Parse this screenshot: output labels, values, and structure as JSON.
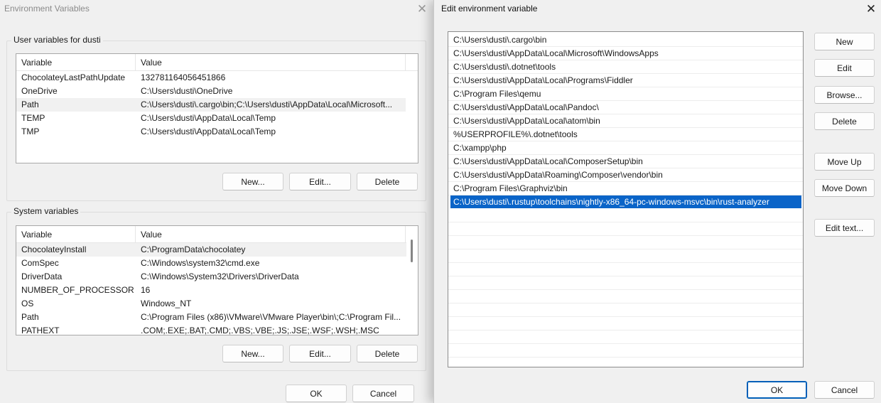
{
  "env_dialog": {
    "title": "Environment Variables",
    "user_group_label": "User variables for dusti",
    "system_group_label": "System variables",
    "columns": {
      "variable": "Variable",
      "value": "Value"
    },
    "user_vars": [
      {
        "name": "ChocolateyLastPathUpdate",
        "value": "132781164056451866"
      },
      {
        "name": "OneDrive",
        "value": "C:\\Users\\dusti\\OneDrive"
      },
      {
        "name": "Path",
        "value": "C:\\Users\\dusti\\.cargo\\bin;C:\\Users\\dusti\\AppData\\Local\\Microsoft..."
      },
      {
        "name": "TEMP",
        "value": "C:\\Users\\dusti\\AppData\\Local\\Temp"
      },
      {
        "name": "TMP",
        "value": "C:\\Users\\dusti\\AppData\\Local\\Temp"
      }
    ],
    "system_vars": [
      {
        "name": "ChocolateyInstall",
        "value": "C:\\ProgramData\\chocolatey"
      },
      {
        "name": "ComSpec",
        "value": "C:\\Windows\\system32\\cmd.exe"
      },
      {
        "name": "DriverData",
        "value": "C:\\Windows\\System32\\Drivers\\DriverData"
      },
      {
        "name": "NUMBER_OF_PROCESSORS",
        "value": "16"
      },
      {
        "name": "OS",
        "value": "Windows_NT"
      },
      {
        "name": "Path",
        "value": "C:\\Program Files (x86)\\VMware\\VMware Player\\bin\\;C:\\Program Fil..."
      },
      {
        "name": "PATHEXT",
        "value": ".COM;.EXE;.BAT;.CMD;.VBS;.VBE;.JS;.JSE;.WSF;.WSH;.MSC"
      }
    ],
    "user_buttons": {
      "new": "New...",
      "edit": "Edit...",
      "delete": "Delete"
    },
    "system_buttons": {
      "new": "New...",
      "edit": "Edit...",
      "delete": "Delete"
    },
    "ok": "OK",
    "cancel": "Cancel",
    "close_glyph": "✕"
  },
  "edit_dialog": {
    "title": "Edit environment variable",
    "close_glyph": "✕",
    "entries": [
      "C:\\Users\\dusti\\.cargo\\bin",
      "C:\\Users\\dusti\\AppData\\Local\\Microsoft\\WindowsApps",
      "C:\\Users\\dusti\\.dotnet\\tools",
      "C:\\Users\\dusti\\AppData\\Local\\Programs\\Fiddler",
      "C:\\Program Files\\qemu",
      "C:\\Users\\dusti\\AppData\\Local\\Pandoc\\",
      "C:\\Users\\dusti\\AppData\\Local\\atom\\bin",
      "%USERPROFILE%\\.dotnet\\tools",
      "C:\\xampp\\php",
      "C:\\Users\\dusti\\AppData\\Local\\ComposerSetup\\bin",
      "C:\\Users\\dusti\\AppData\\Roaming\\Composer\\vendor\\bin",
      "C:\\Program Files\\Graphviz\\bin",
      "C:\\Users\\dusti\\.rustup\\toolchains\\nightly-x86_64-pc-windows-msvc\\bin\\rust-analyzer"
    ],
    "selected_index": 12,
    "buttons": {
      "new": "New",
      "edit": "Edit",
      "browse": "Browse...",
      "delete": "Delete",
      "move_up": "Move Up",
      "move_down": "Move Down",
      "edit_text": "Edit text..."
    },
    "ok": "OK",
    "cancel": "Cancel",
    "selection_color": "#0a64c8",
    "default_button_border": "#005fb8"
  }
}
